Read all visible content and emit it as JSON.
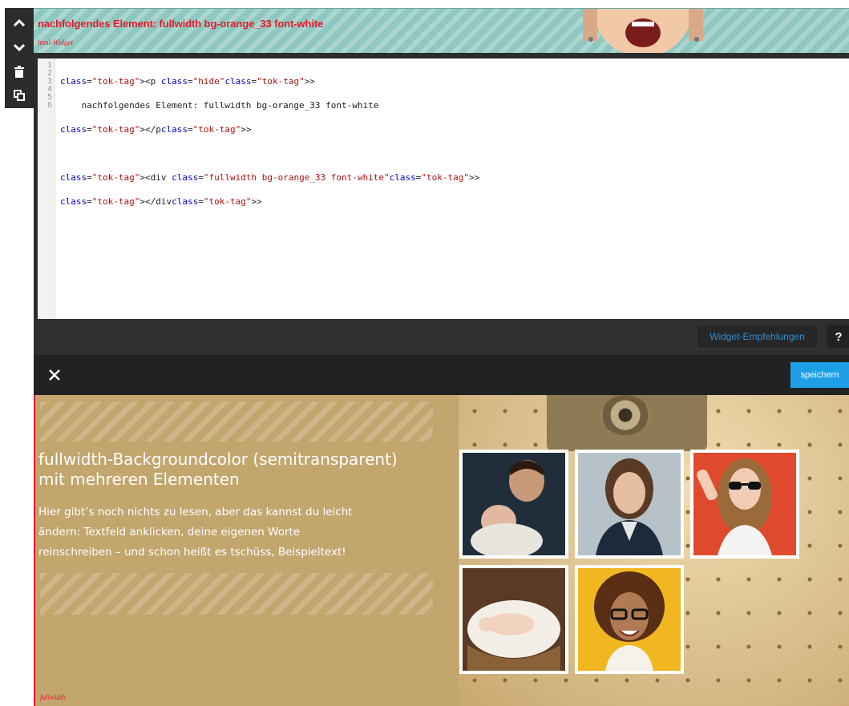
{
  "toolbar": {
    "icons": [
      "chevron-up-icon",
      "chevron-down-icon",
      "trash-icon",
      "duplicate-icon"
    ]
  },
  "widget": {
    "title": "nachfolgendes Element: fullwidth bg-orange_33 font-white",
    "type_label": "html-Widget"
  },
  "editor": {
    "line_numbers": [
      "1",
      "2",
      "3",
      "4",
      "5",
      "6"
    ],
    "lines": [
      "<p class=\"hide\">",
      "    nachfolgendes Element: fullwidth bg-orange_33 font-white",
      "</p>",
      "",
      "<div class=\"fullwidth bg-orange_33 font-white\">",
      "</div>"
    ]
  },
  "footer": {
    "recommend_label": "Widget-Empfehlungen",
    "help_label": "?"
  },
  "savebar": {
    "close_icon": "close-icon",
    "save_label": "speichern"
  },
  "preview": {
    "heading_line1": "fullwidth-Backgroundcolor (semitransparent)",
    "heading_line2": "mit mehreren Elementen",
    "text_line1": "Hier gibt’s noch nichts zu lesen, aber das kannst du leicht",
    "text_line2": "ändern: Textfeld anklicken, deine eigenen Worte",
    "text_line3": "reinschreiben – und schon heißt es tschüss, Beispieltext!",
    "section_label": "fullwidth"
  },
  "colors": {
    "accent_red": "#e8192c",
    "save_blue": "#1da0e8",
    "link_blue": "#2a8fd6"
  }
}
